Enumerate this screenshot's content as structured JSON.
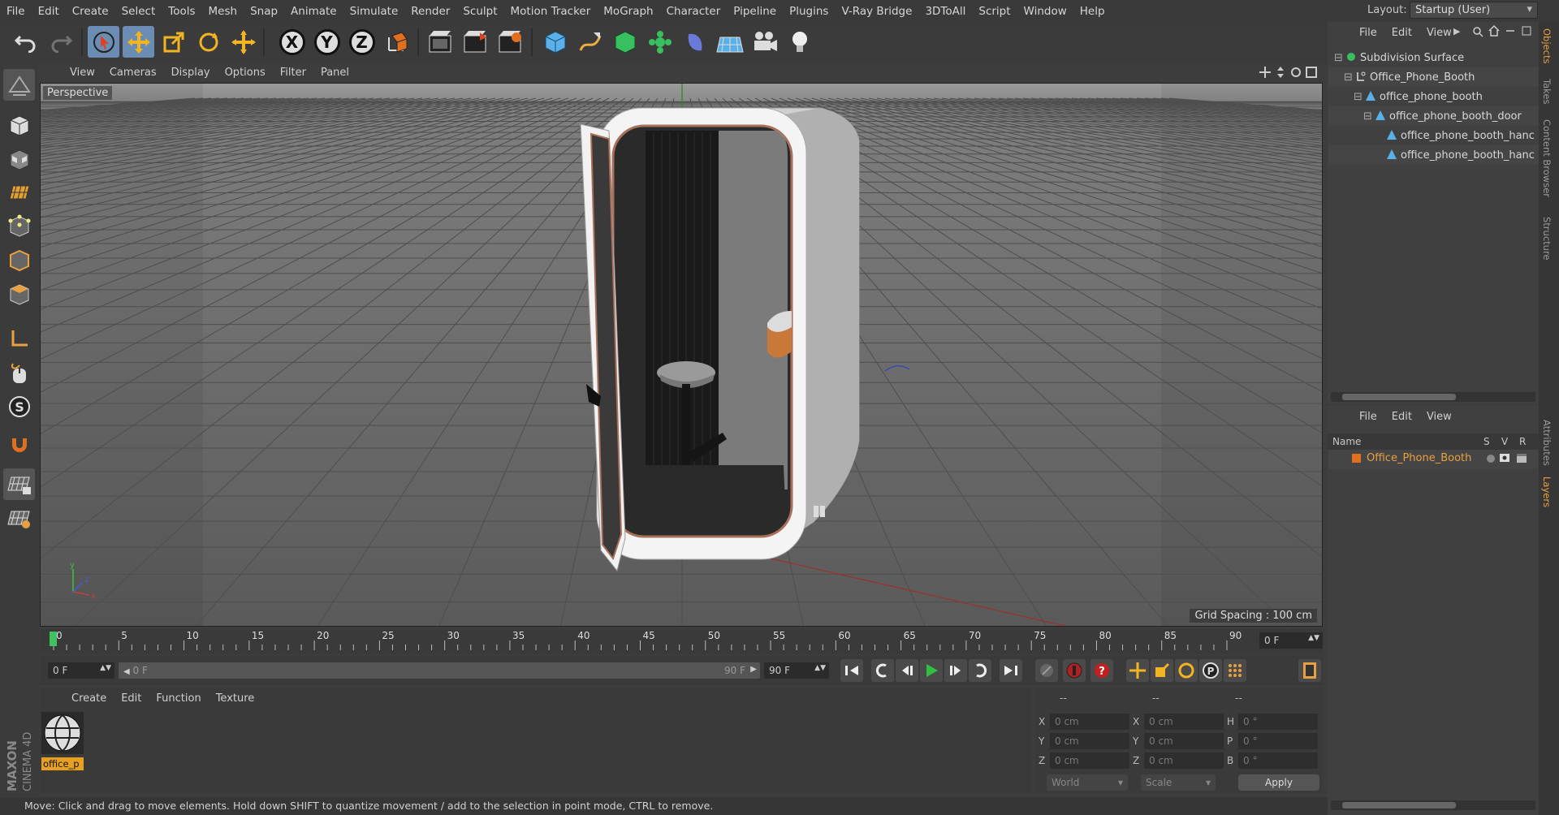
{
  "menubar": {
    "items": [
      "File",
      "Edit",
      "Create",
      "Select",
      "Tools",
      "Mesh",
      "Snap",
      "Animate",
      "Simulate",
      "Render",
      "Sculpt",
      "Motion Tracker",
      "MoGraph",
      "Character",
      "Pipeline",
      "Plugins",
      "V-Ray Bridge",
      "3DToAll",
      "Script",
      "Window",
      "Help"
    ],
    "layout_label": "Layout:",
    "layout_value": "Startup (User)"
  },
  "toolbar": {
    "axis_x": "X",
    "axis_y": "Y",
    "axis_z": "Z"
  },
  "viewport": {
    "menu": [
      "View",
      "Cameras",
      "Display",
      "Options",
      "Filter",
      "Panel"
    ],
    "label": "Perspective",
    "grid_spacing": "Grid Spacing : 100 cm",
    "axis_x": "x",
    "axis_y": "y",
    "axis_z": "z"
  },
  "timeline": {
    "ticks": [
      "0",
      "5",
      "10",
      "15",
      "20",
      "25",
      "30",
      "35",
      "40",
      "45",
      "50",
      "55",
      "60",
      "65",
      "70",
      "75",
      "80",
      "85",
      "90"
    ],
    "end_frame": "0 F",
    "current_frame": "0 F",
    "range_start": "0 F",
    "range_end_inner": "90 F",
    "range_end": "90 F"
  },
  "material_panel": {
    "menu": [
      "Create",
      "Edit",
      "Function",
      "Texture"
    ],
    "material_name": "office_p"
  },
  "coord_panel": {
    "col_headers": [
      "--",
      "--",
      "--"
    ],
    "rows": [
      {
        "a": "X",
        "av": "0 cm",
        "b": "X",
        "bv": "0 cm",
        "c": "H",
        "cv": "0 °"
      },
      {
        "a": "Y",
        "av": "0 cm",
        "b": "Y",
        "bv": "0 cm",
        "c": "P",
        "cv": "0 °"
      },
      {
        "a": "Z",
        "av": "0 cm",
        "b": "Z",
        "bv": "0 cm",
        "c": "B",
        "cv": "0 °"
      }
    ],
    "mode_world": "World",
    "mode_scale": "Scale",
    "apply": "Apply"
  },
  "status": "Move: Click and drag to move elements. Hold down SHIFT to quantize movement / add to the selection in point mode, CTRL to remove.",
  "object_panel": {
    "menu": [
      "File",
      "Edit",
      "View"
    ],
    "tree": [
      {
        "name": "Subdivision Surface"
      },
      {
        "name": "Office_Phone_Booth"
      },
      {
        "name": "office_phone_booth"
      },
      {
        "name": "office_phone_booth_door"
      },
      {
        "name": "office_phone_booth_hanc"
      },
      {
        "name": "office_phone_booth_hanc"
      }
    ]
  },
  "layer_panel": {
    "menu": [
      "File",
      "Edit",
      "View"
    ],
    "col_name": "Name",
    "col_s": "S",
    "col_v": "V",
    "col_r": "R",
    "layer_name": "Office_Phone_Booth",
    "layer_color": "#e07020"
  },
  "side_tabs": [
    "Objects",
    "Takes",
    "Content Browser",
    "Structure",
    "Attributes",
    "Layers"
  ],
  "brand": {
    "line1": "MAXON",
    "line2": "CINEMA 4D"
  },
  "colors": {
    "accent": "#6b8cb3",
    "selection": "#e8a040"
  }
}
